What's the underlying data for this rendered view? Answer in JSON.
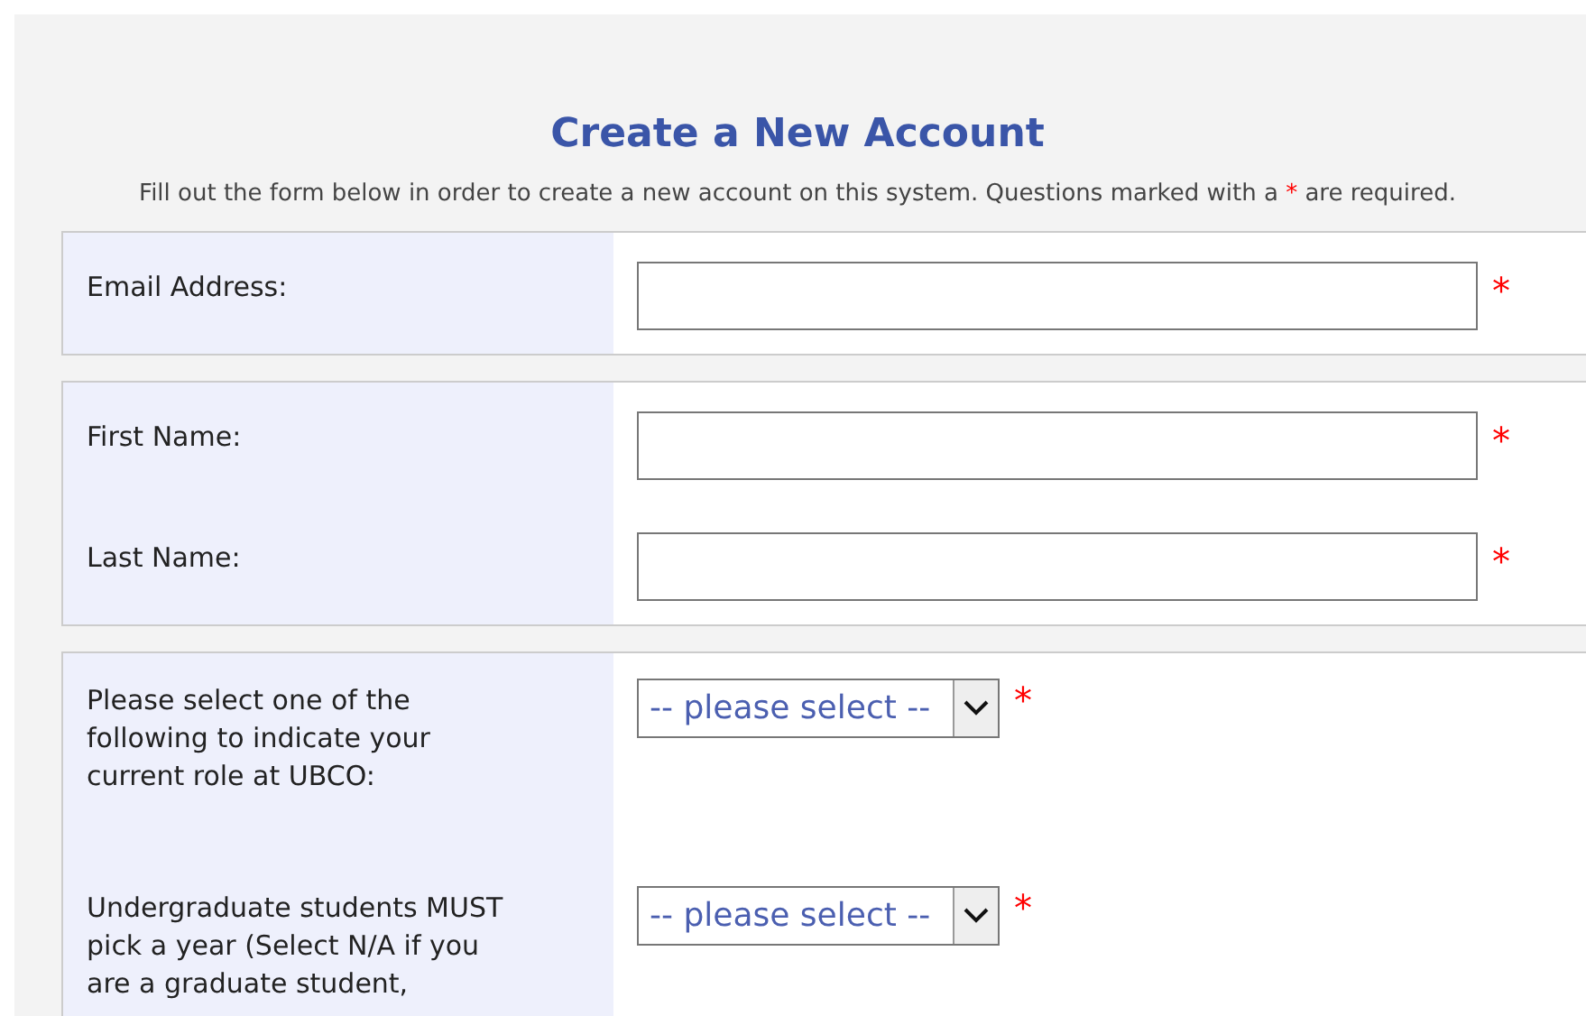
{
  "title": "Create a New Account",
  "intro": {
    "before": "Fill out the form below in order to create a new account on this system. Questions marked with a",
    "mark": "*",
    "after": "are required."
  },
  "sections": [
    {
      "fields": [
        {
          "kind": "text",
          "label": "Email Address:",
          "required": true,
          "required_mark": "*"
        }
      ]
    },
    {
      "fields": [
        {
          "kind": "text",
          "label": "First Name:",
          "required": true,
          "required_mark": "*"
        },
        {
          "kind": "text",
          "label": "Last Name:",
          "required": true,
          "required_mark": "*"
        }
      ]
    },
    {
      "fields": [
        {
          "kind": "select",
          "label": "Please select one of the following to indicate your current role at UBCO:",
          "value": "-- please select --",
          "required": true,
          "required_mark": "*"
        },
        {
          "kind": "select",
          "label": "Undergraduate students MUST pick a year (Select N/A if you are a graduate student,",
          "value": "-- please select --",
          "required": true,
          "required_mark": "*"
        }
      ]
    }
  ]
}
